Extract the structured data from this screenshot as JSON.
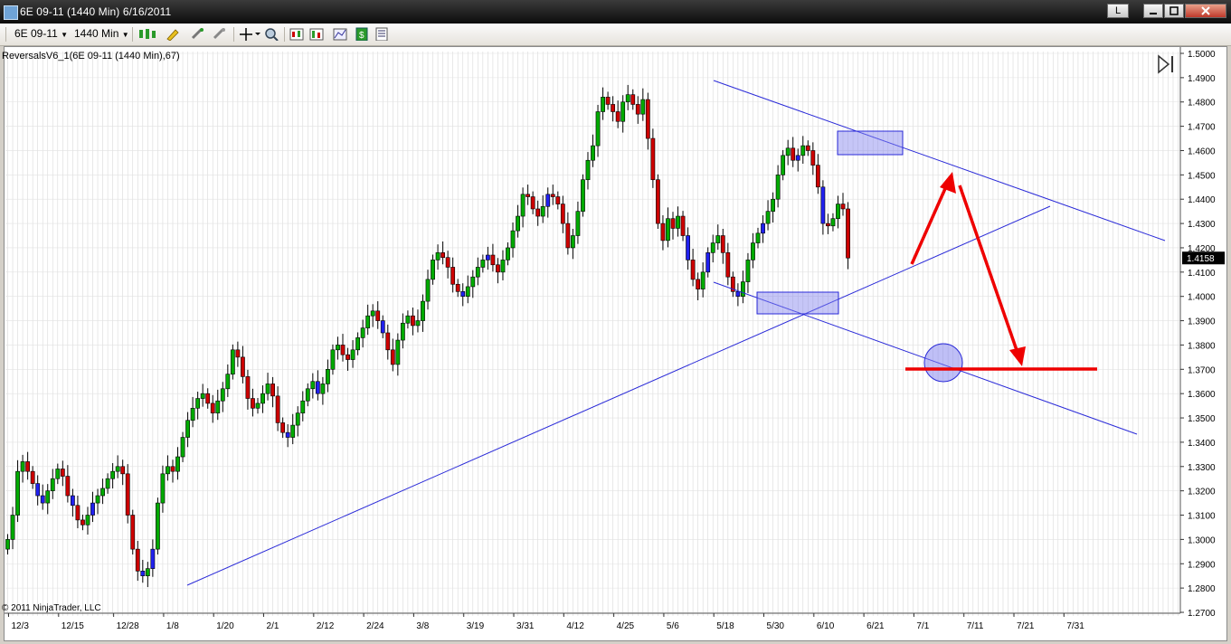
{
  "window": {
    "title": "6E 09-11 (1440 Min)  6/16/2011",
    "min_label": "L"
  },
  "toolbar": {
    "instrument": "6E 09-11",
    "period": "1440 Min"
  },
  "chart": {
    "indicator_label": "ReversalsV6_1(6E 09-11 (1440 Min),67)",
    "copyright": "© 2011 NinjaTrader, LLC",
    "last_price": "1.4158"
  },
  "chart_data": {
    "type": "candlestick",
    "symbol": "6E 09-11",
    "period": "1440 Min",
    "y_ticks": [
      "1.5000",
      "1.4900",
      "1.4800",
      "1.4700",
      "1.4600",
      "1.4500",
      "1.4400",
      "1.4300",
      "1.4200",
      "1.4100",
      "1.4000",
      "1.3900",
      "1.3800",
      "1.3700",
      "1.3600",
      "1.3500",
      "1.3400",
      "1.3300",
      "1.3200",
      "1.3100",
      "1.3000",
      "1.2900",
      "1.2800",
      "1.2700"
    ],
    "ylim": [
      1.27,
      1.5
    ],
    "x_ticks": [
      "12/3",
      "12/15",
      "12/28",
      "1/8",
      "1/20",
      "2/1",
      "2/12",
      "2/24",
      "3/8",
      "3/19",
      "3/31",
      "4/12",
      "4/25",
      "5/6",
      "5/18",
      "5/30",
      "6/10",
      "6/21",
      "7/1",
      "7/11",
      "7/21",
      "7/31"
    ],
    "last_price": 1.4158,
    "closes": [
      1.3,
      1.31,
      1.328,
      1.332,
      1.328,
      1.323,
      1.318,
      1.315,
      1.32,
      1.325,
      1.329,
      1.326,
      1.318,
      1.314,
      1.308,
      1.306,
      1.31,
      1.315,
      1.318,
      1.321,
      1.325,
      1.328,
      1.33,
      1.327,
      1.31,
      1.296,
      1.287,
      1.285,
      1.288,
      1.296,
      1.315,
      1.327,
      1.33,
      1.328,
      1.334,
      1.342,
      1.349,
      1.354,
      1.358,
      1.36,
      1.356,
      1.352,
      1.357,
      1.362,
      1.368,
      1.378,
      1.375,
      1.367,
      1.358,
      1.354,
      1.356,
      1.36,
      1.364,
      1.359,
      1.348,
      1.344,
      1.342,
      1.347,
      1.352,
      1.357,
      1.362,
      1.365,
      1.36,
      1.364,
      1.37,
      1.378,
      1.38,
      1.376,
      1.374,
      1.378,
      1.383,
      1.387,
      1.392,
      1.394,
      1.39,
      1.385,
      1.378,
      1.372,
      1.382,
      1.389,
      1.392,
      1.388,
      1.39,
      1.398,
      1.407,
      1.415,
      1.418,
      1.416,
      1.412,
      1.405,
      1.402,
      1.4,
      1.404,
      1.408,
      1.412,
      1.415,
      1.417,
      1.413,
      1.41,
      1.415,
      1.42,
      1.427,
      1.433,
      1.442,
      1.441,
      1.436,
      1.433,
      1.437,
      1.442,
      1.441,
      1.438,
      1.43,
      1.42,
      1.425,
      1.435,
      1.448,
      1.456,
      1.462,
      1.476,
      1.482,
      1.479,
      1.476,
      1.472,
      1.48,
      1.483,
      1.479,
      1.475,
      1.481,
      1.465,
      1.448,
      1.43,
      1.423,
      1.432,
      1.428,
      1.433,
      1.425,
      1.415,
      1.407,
      1.403,
      1.41,
      1.418,
      1.422,
      1.425,
      1.418,
      1.408,
      1.402,
      1.4,
      1.406,
      1.415,
      1.422,
      1.426,
      1.43,
      1.435,
      1.44,
      1.45,
      1.458,
      1.461,
      1.456,
      1.458,
      1.462,
      1.46,
      1.454,
      1.445,
      1.43,
      1.429,
      1.432,
      1.438,
      1.436,
      1.4158
    ],
    "annotations": {
      "upper_channel_line": "descending",
      "lower_channel_line": "descending",
      "support_line": "ascending from 1/8 low",
      "target_level": 1.37
    }
  },
  "colors": {
    "up_candle": "#00aa00",
    "down_candle": "#cc0000",
    "reversal_candle": "#2020ee",
    "trend_lines": "#2a2ad8",
    "arrows": "#ee0000",
    "highlight_box": "#8080ee"
  },
  "icons": [
    "candles-icon",
    "pencil-icon",
    "magnet-icon",
    "crosshair-icon",
    "zoom-icon",
    "bar-style-icon",
    "properties-icon",
    "indicator-icon",
    "strategy-icon",
    "dom-icon",
    "dock-icon"
  ]
}
